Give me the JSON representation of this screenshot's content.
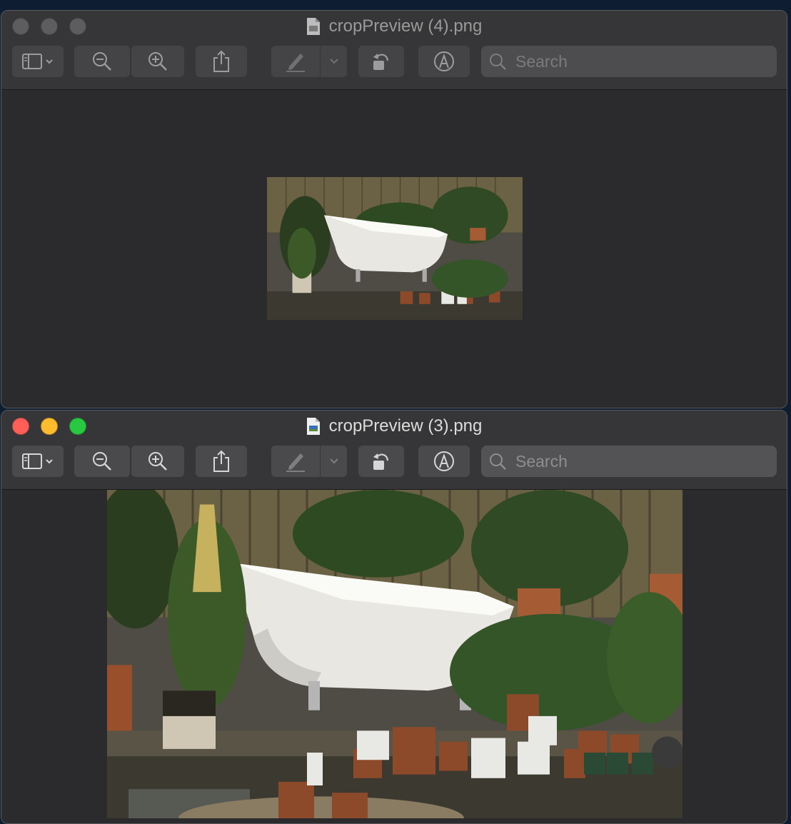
{
  "windows": [
    {
      "title": "cropPreview (4).png",
      "active": false,
      "search": {
        "placeholder": "Search",
        "value": ""
      },
      "image_alt": "bathtub-garden-photo"
    },
    {
      "title": "cropPreview (3).png",
      "active": true,
      "search": {
        "placeholder": "Search",
        "value": ""
      },
      "image_alt": "bathtub-garden-photo"
    }
  ],
  "colors": {
    "close": "#ff5f57",
    "minimize": "#febc2e",
    "zoom": "#28c840",
    "inactive_light": "#5d5d5f"
  },
  "toolbar_icons": [
    "sidebar-icon",
    "zoom-out-icon",
    "zoom-in-icon",
    "share-icon",
    "markup-pen-icon",
    "chevron-down-icon",
    "rotate-icon",
    "annotate-icon",
    "search-icon"
  ]
}
